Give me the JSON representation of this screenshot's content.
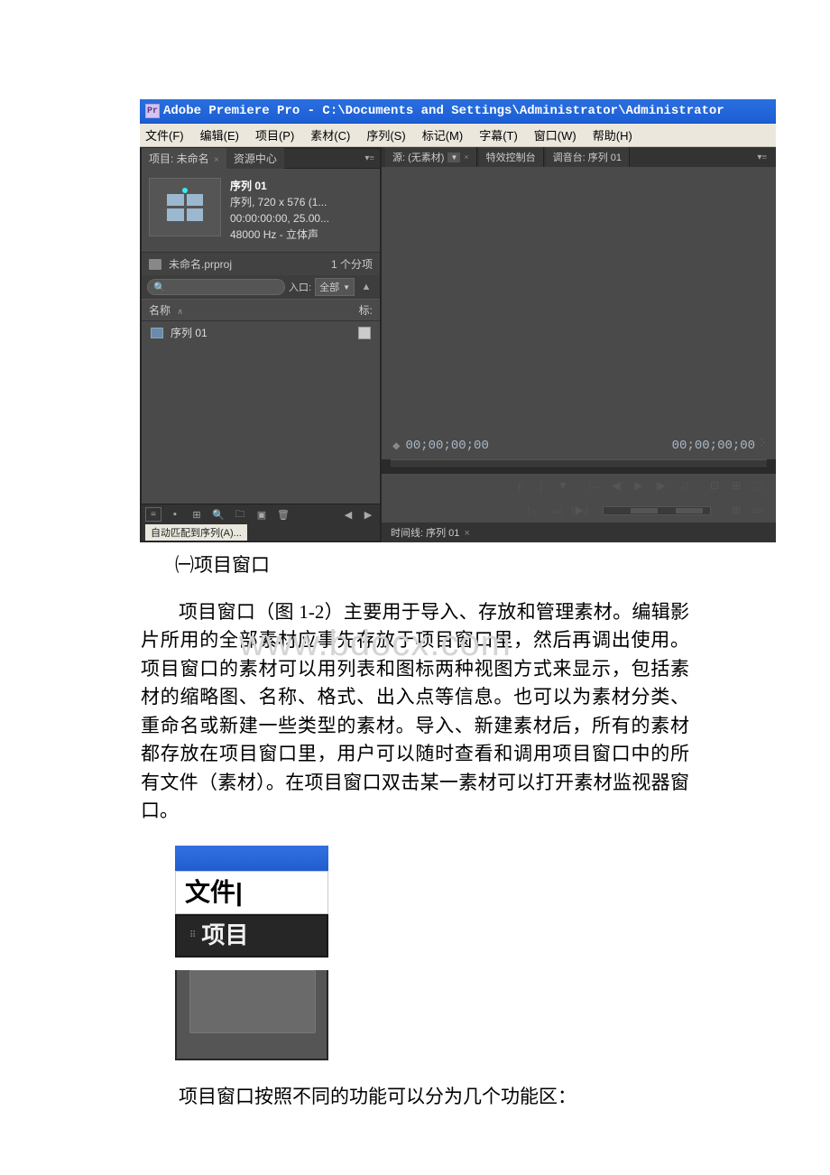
{
  "titlebar": {
    "app_icon": "Pr",
    "title": "Adobe Premiere Pro - C:\\Documents and Settings\\Administrator\\Administrator"
  },
  "menu": {
    "file": "文件(F)",
    "edit": "编辑(E)",
    "project": "项目(P)",
    "clip": "素材(C)",
    "sequence": "序列(S)",
    "marker": "标记(M)",
    "title": "字幕(T)",
    "window": "窗口(W)",
    "help": "帮助(H)"
  },
  "project_panel": {
    "tab_project": "项目: 未命名",
    "tab_resource": "资源中心",
    "preview": {
      "name": "序列 01",
      "line1": "序列, 720 x 576 (1...",
      "line2": "00:00:00:00, 25.00...",
      "line3": "48000 Hz - 立体声"
    },
    "file_row": {
      "name": "未命名.prproj",
      "count": "1 个分项"
    },
    "search": {
      "entry_label": "入口:",
      "entry_value": "全部"
    },
    "columns": {
      "name": "名称",
      "tag": "标:"
    },
    "list_item": "序列 01",
    "auto_match": "自动匹配到序列(A)..."
  },
  "source_panel": {
    "tab_source": "源: (无素材)",
    "tab_effects": "特效控制台",
    "tab_mixer": "调音台: 序列 01",
    "tc_left": "00;00;00;00",
    "tc_right": "00;00;00;00"
  },
  "timeline": {
    "tab": "时间线: 序列 01"
  },
  "watermark": "www.bdocx.com",
  "doc": {
    "section_title": "㈠项目窗口",
    "para1": "项目窗口（图 1-2）主要用于导入、存放和管理素材。编辑影片所用的全部素材应事先存放于项目窗口里，然后再调出使用。项目窗口的素材可以用列表和图标两种视图方式来显示，包括素材的缩略图、名称、格式、出入点等信息。也可以为素材分类、重命名或新建一些类型的素材。导入、新建素材后，所有的素材都存放在项目窗口里，用户可以随时查看和调用项目窗口中的所有文件（素材）。在项目窗口双击某一素材可以打开素材监视器窗口。",
    "crop_text1": "文件",
    "crop_text2": "项目",
    "para2": "项目窗口按照不同的功能可以分为几个功能区："
  }
}
